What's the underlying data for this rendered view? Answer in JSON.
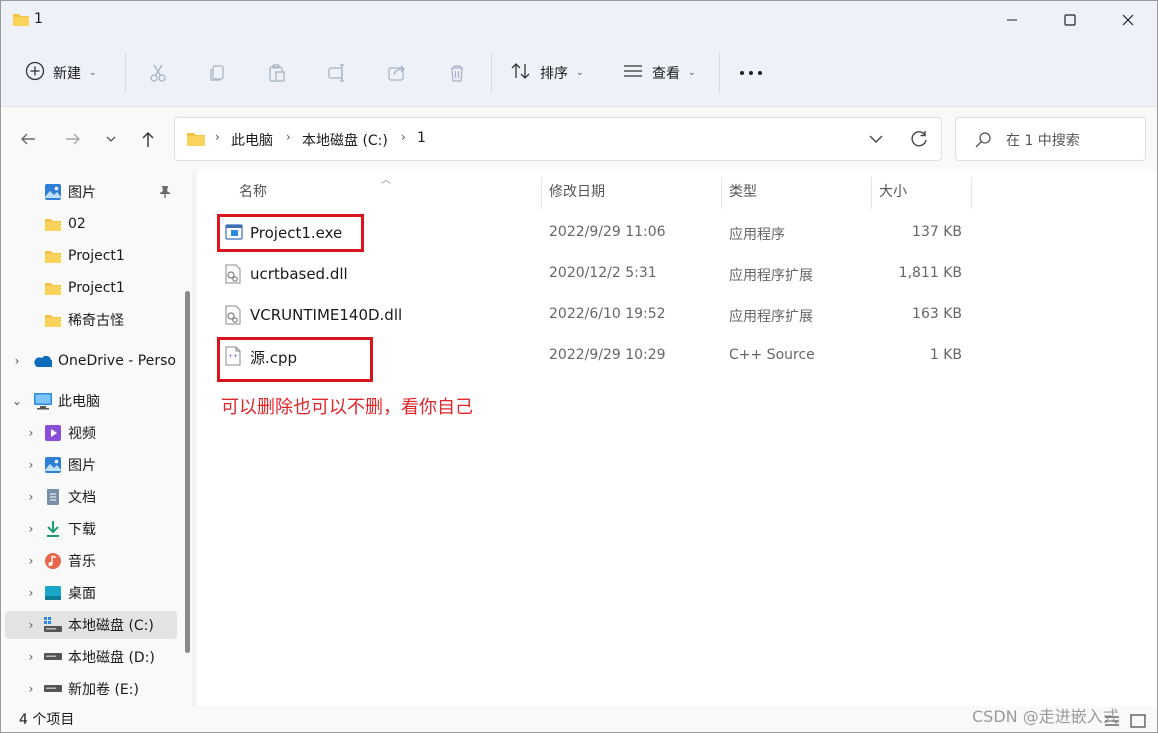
{
  "window": {
    "title": "1"
  },
  "toolbar": {
    "new_label": "新建",
    "sort_label": "排序",
    "view_label": "查看"
  },
  "address": {
    "segments": [
      "此电脑",
      "本地磁盘 (C:)",
      "1"
    ]
  },
  "search": {
    "placeholder": "在 1 中搜索"
  },
  "sidebar": {
    "items": [
      {
        "label": "图片",
        "icon": "pictures-icon"
      },
      {
        "label": "02",
        "icon": "folder-icon"
      },
      {
        "label": "Project1",
        "icon": "folder-icon"
      },
      {
        "label": "Project1",
        "icon": "folder-icon"
      },
      {
        "label": "稀奇古怪",
        "icon": "folder-icon"
      },
      {
        "label": "OneDrive - Perso",
        "icon": "onedrive-icon"
      },
      {
        "label": "此电脑",
        "icon": "computer-icon"
      },
      {
        "label": "视频",
        "icon": "videos-icon"
      },
      {
        "label": "图片",
        "icon": "pictures-icon"
      },
      {
        "label": "文档",
        "icon": "documents-icon"
      },
      {
        "label": "下载",
        "icon": "downloads-icon"
      },
      {
        "label": "音乐",
        "icon": "music-icon"
      },
      {
        "label": "桌面",
        "icon": "desktop-icon"
      },
      {
        "label": "本地磁盘 (C:)",
        "icon": "drive-c-icon"
      },
      {
        "label": "本地磁盘 (D:)",
        "icon": "drive-icon"
      },
      {
        "label": "新加卷 (E:)",
        "icon": "drive-icon"
      }
    ]
  },
  "columns": {
    "name": "名称",
    "modified": "修改日期",
    "type": "类型",
    "size": "大小"
  },
  "files": [
    {
      "name": "Project1.exe",
      "modified": "2022/9/29 11:06",
      "type": "应用程序",
      "size": "137 KB",
      "icon": "exe-icon"
    },
    {
      "name": "ucrtbased.dll",
      "modified": "2020/12/2 5:31",
      "type": "应用程序扩展",
      "size": "1,811 KB",
      "icon": "dll-icon"
    },
    {
      "name": "VCRUNTIME140D.dll",
      "modified": "2022/6/10 19:52",
      "type": "应用程序扩展",
      "size": "163 KB",
      "icon": "dll-icon"
    },
    {
      "name": "源.cpp",
      "modified": "2022/9/29 10:29",
      "type": "C++ Source",
      "size": "1 KB",
      "icon": "cpp-icon"
    }
  ],
  "annotation": "可以删除也可以不删，看你自己",
  "status": {
    "item_count": "4 个项目"
  },
  "watermark": "CSDN @走进嵌入式"
}
